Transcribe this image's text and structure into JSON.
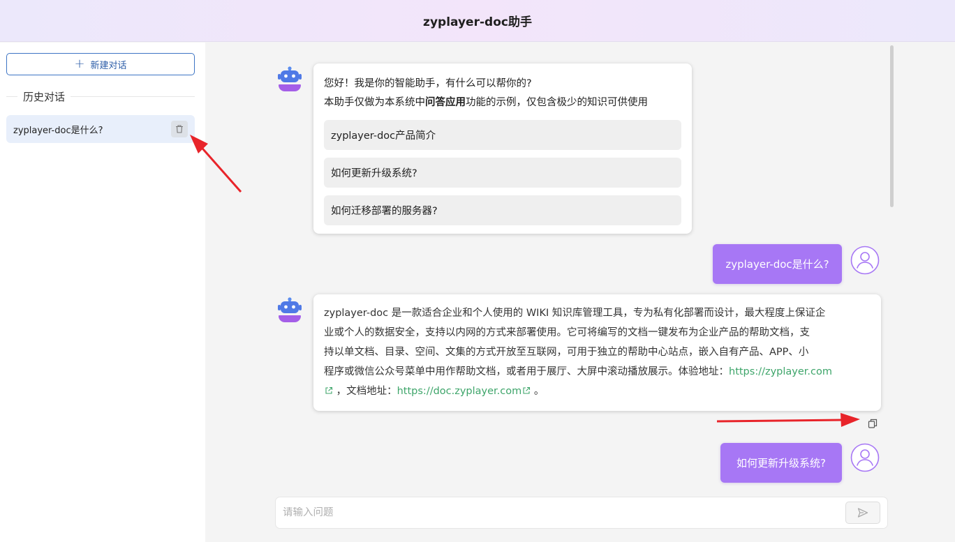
{
  "header": {
    "title": "zyplayer-doc助手"
  },
  "sidebar": {
    "new_chat_label": "新建对话",
    "history_heading": "历史对话",
    "history_items": [
      {
        "title": "zyplayer-doc是什么?"
      }
    ]
  },
  "greeting": {
    "line1": "您好！我是你的智能助手，有什么可以帮你的?",
    "line2_prefix": "本助手仅做为本系统中",
    "line2_bold": "问答应用",
    "line2_suffix": "功能的示例，仅包含极少的知识可供使用",
    "suggestions": [
      "zyplayer-doc产品简介",
      "如何更新升级系统?",
      "如何迁移部署的服务器?"
    ]
  },
  "messages": [
    {
      "role": "user",
      "text": "zyplayer-doc是什么?"
    },
    {
      "role": "bot",
      "lines": [
        "zyplayer-doc 是一款适合企业和个人使用的 WIKI 知识库管理工具，专为私有化部署而设计，最大程度上保证企",
        "业或个人的数据安全，支持以内网的方式来部署使用。它可将编写的文档一键发布为企业产品的帮助文档，支",
        "持以单文档、目录、空间、文集的方式开放至互联网，可用于独立的帮助中心站点，嵌入自有产品、APP、小",
        "程序或微信公众号菜单中用作帮助文档，或者用于展厅、大屏中滚动播放展示。体验地址："
      ],
      "link1": "https://zyplayer.com",
      "mid_text": "，文档地址：",
      "link2": "https://doc.zyplayer.com",
      "end_text": "。"
    },
    {
      "role": "user",
      "text": "如何更新升级系统?"
    }
  ],
  "input": {
    "placeholder": "请输入问题"
  },
  "colors": {
    "user_bubble": "#a777f5",
    "link": "#3ea56a",
    "accent_blue": "#3d74c4",
    "annotation_arrow": "#e8242a"
  },
  "icons": [
    "plus-icon",
    "trash-icon",
    "robot-icon",
    "user-icon",
    "external-link-icon",
    "copy-icon",
    "send-icon"
  ]
}
